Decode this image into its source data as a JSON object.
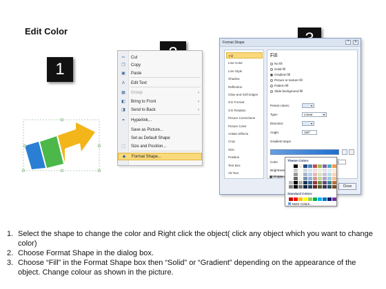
{
  "title": "Edit Color",
  "badges": [
    "1",
    "2",
    "3"
  ],
  "context_menu": {
    "items": [
      {
        "label": "Cut",
        "icon": "scissors-icon",
        "glyph": "✂",
        "disabled": false,
        "submenu": false
      },
      {
        "label": "Copy",
        "icon": "copy-icon",
        "glyph": "❐",
        "disabled": false,
        "submenu": false
      },
      {
        "label": "Paste",
        "icon": "paste-icon",
        "glyph": "▣",
        "disabled": false,
        "submenu": false
      },
      {
        "label": "Edit Text",
        "icon": "text-box-icon",
        "glyph": "A",
        "disabled": false,
        "submenu": false
      },
      {
        "label": "Group",
        "icon": "group-icon",
        "glyph": "▦",
        "disabled": true,
        "submenu": true
      },
      {
        "label": "Bring to Front",
        "icon": "bring-front-icon",
        "glyph": "◧",
        "disabled": false,
        "submenu": true
      },
      {
        "label": "Send to Back",
        "icon": "send-back-icon",
        "glyph": "◨",
        "disabled": false,
        "submenu": true
      },
      {
        "label": "Hyperlink...",
        "icon": "hyperlink-icon",
        "glyph": "⚭",
        "disabled": false,
        "submenu": false
      },
      {
        "label": "Save as Picture...",
        "icon": "",
        "glyph": "",
        "disabled": false,
        "submenu": false
      },
      {
        "label": "Set as Default Shape",
        "icon": "",
        "glyph": "",
        "disabled": false,
        "submenu": false
      },
      {
        "label": "Size and Position...",
        "icon": "size-position-icon",
        "glyph": "⬚",
        "disabled": false,
        "submenu": false
      },
      {
        "label": "Format Shape...",
        "icon": "format-shape-icon",
        "glyph": "◆",
        "disabled": false,
        "submenu": false
      }
    ],
    "submenu_glyph": "›"
  },
  "dialog": {
    "title": "Format Shape",
    "window_buttons": [
      "?",
      "✕"
    ],
    "nav": [
      "Fill",
      "Line Color",
      "Line Style",
      "Shadow",
      "Reflection",
      "Glow and Soft Edges",
      "3-D Format",
      "3-D Rotation",
      "Picture Corrections",
      "Picture Color",
      "Artistic Effects",
      "Crop",
      "Size",
      "Position",
      "Text Box",
      "Alt Text"
    ],
    "selected_nav": "Fill",
    "panel_title": "Fill",
    "fill_options": [
      {
        "label": "No fill",
        "on": false
      },
      {
        "label": "Solid fill",
        "on": false
      },
      {
        "label": "Gradient fill",
        "on": true
      },
      {
        "label": "Picture or texture fill",
        "on": false
      },
      {
        "label": "Pattern fill",
        "on": false
      },
      {
        "label": "Slide background fill",
        "on": false
      }
    ],
    "preset_colors_label": "Preset colors:",
    "type_label": "Type:",
    "type_value": "Linear",
    "direction_label": "Direction:",
    "angle_label": "Angle:",
    "angle_value": "180°",
    "gradient_stops_label": "Gradient stops",
    "color_label": "Color",
    "position_label": "Position:",
    "position_value": "0%",
    "brightness_label": "Brightness:",
    "transparency_label": "Transparency:",
    "rotate_label": "Rotate with shape",
    "close_label": "Close"
  },
  "palette": {
    "theme_label": "Theme Colors",
    "standard_label": "Standard Colors",
    "more_label": "More Colors...",
    "theme_top": [
      "#ffffff",
      "#000000",
      "#eeece1",
      "#1f497d",
      "#4f81bd",
      "#c0504d",
      "#9bbb59",
      "#8064a2",
      "#4bacc6",
      "#f79646"
    ],
    "standard": [
      "#c00000",
      "#ff0000",
      "#ffc000",
      "#ffff00",
      "#92d050",
      "#00b050",
      "#00b0f0",
      "#0070c0",
      "#002060",
      "#7030a0"
    ]
  },
  "instructions": [
    {
      "num": "1.",
      "text": "Select the shape to change the color and Right click the object( click any object which you want to change color)"
    },
    {
      "num": "2.",
      "text": "Choose Format Shape in the dialog box."
    },
    {
      "num": "3.",
      "text": "Choose “Fill” in the Format Shape box then “Solid” or “Gradient” depending on the appearance of the object. Change colour as shown in the picture."
    }
  ]
}
